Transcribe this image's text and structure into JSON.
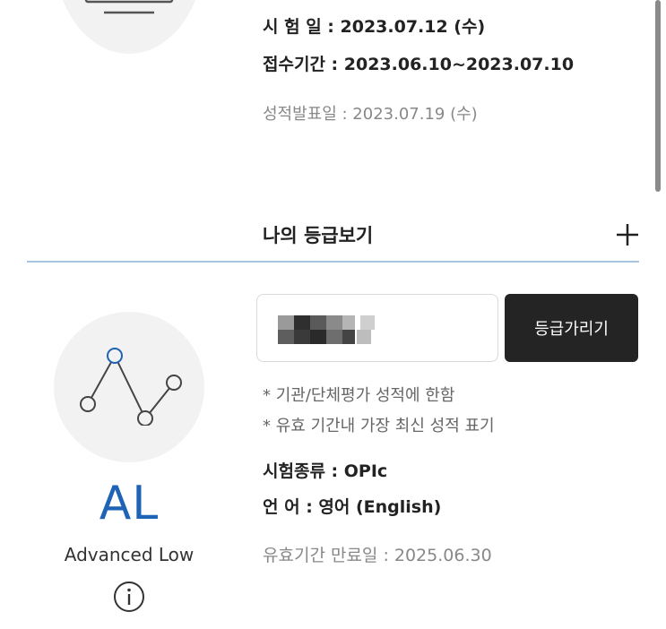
{
  "exam_schedule": {
    "exam_date": "시  험  일 : 2023.07.12 (수)",
    "registration_period": "접수기간 : 2023.06.10~2023.07.10",
    "result_date": "성적발표일 : 2023.07.19 (수)"
  },
  "grade_section": {
    "title": "나의 등급보기",
    "expand_icon": "plus-icon"
  },
  "grade_card": {
    "grade_code": "AL",
    "grade_name": "Advanced Low",
    "info_icon": "info-circle-icon",
    "grade_color": "#1e63b5"
  },
  "grade_actions": {
    "hide_button_label": "등급가리기",
    "button_color": "#242424"
  },
  "notes": [
    "* 기관/단체평가 성적에 한함",
    "* 유효 기간내 가장 최신 성적 표기"
  ],
  "details": {
    "exam_type": "시험종류 : OPIc",
    "language": "언       어 : 영어 (English)",
    "expiry": "유효기간 만료일 : 2025.06.30"
  }
}
